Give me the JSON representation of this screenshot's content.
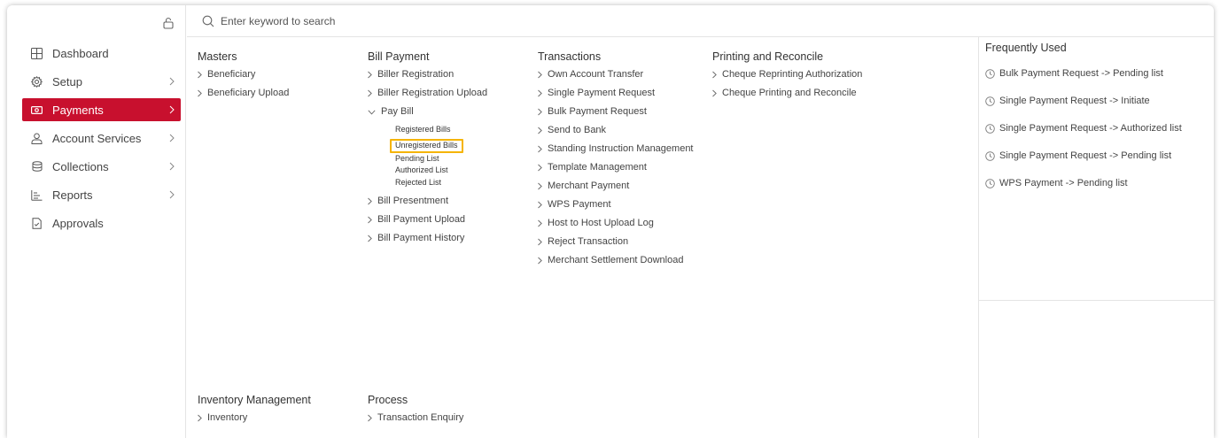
{
  "search": {
    "placeholder": "Enter keyword to search"
  },
  "sidebar": {
    "items": [
      {
        "label": "Dashboard",
        "icon": "dashboard-icon",
        "chevron": false
      },
      {
        "label": "Setup",
        "icon": "gear-icon",
        "chevron": true
      },
      {
        "label": "Payments",
        "icon": "payments-icon",
        "chevron": true,
        "active": true
      },
      {
        "label": "Account Services",
        "icon": "user-icon",
        "chevron": true
      },
      {
        "label": "Collections",
        "icon": "coins-icon",
        "chevron": true
      },
      {
        "label": "Reports",
        "icon": "reports-icon",
        "chevron": true
      },
      {
        "label": "Approvals",
        "icon": "approvals-icon",
        "chevron": false
      }
    ],
    "active_color": "#c8102e"
  },
  "menu": {
    "masters": {
      "title": "Masters",
      "items": [
        "Beneficiary",
        "Beneficiary Upload"
      ]
    },
    "bill_payment": {
      "title": "Bill Payment",
      "items": [
        "Biller Registration",
        "Biller Registration Upload"
      ],
      "pay_bill": {
        "label": "Pay Bill",
        "sub": [
          "Registered Bills",
          "Unregistered Bills",
          "Pending List",
          "Authorized List",
          "Rejected List"
        ]
      },
      "items_after": [
        "Bill Presentment",
        "Bill Payment Upload",
        "Bill Payment History"
      ]
    },
    "transactions": {
      "title": "Transactions",
      "items": [
        "Own Account Transfer",
        "Single Payment Request",
        "Bulk Payment Request",
        "Send to Bank",
        "Standing Instruction Management",
        "Template Management",
        "Merchant Payment",
        "WPS Payment",
        "Host to Host Upload Log",
        "Reject Transaction",
        "Merchant Settlement Download"
      ]
    },
    "printing": {
      "title": "Printing and Reconcile",
      "items": [
        "Cheque Reprinting Authorization",
        "Cheque Printing and Reconcile"
      ]
    },
    "inventory": {
      "title": "Inventory Management",
      "items": [
        "Inventory"
      ]
    },
    "process": {
      "title": "Process",
      "items": [
        "Transaction Enquiry"
      ]
    }
  },
  "frequently_used": {
    "title": "Frequently Used",
    "items": [
      "Bulk Payment Request -> Pending list",
      "Single Payment Request -> Initiate",
      "Single Payment Request -> Authorized list",
      "Single Payment Request -> Pending list",
      "WPS Payment -> Pending list"
    ]
  },
  "highlight_color": "#f5b400"
}
